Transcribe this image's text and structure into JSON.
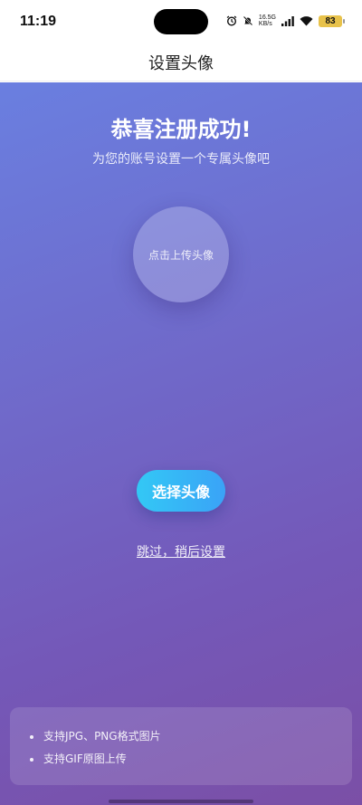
{
  "status_bar": {
    "time": "11:19",
    "net_speed_top": "16.5G",
    "net_speed_bottom": "KB/s",
    "battery": "83"
  },
  "nav": {
    "title": "设置头像"
  },
  "main": {
    "headline": "恭喜注册成功!",
    "subline": "为您的账号设置一个专属头像吧",
    "avatar_hint": "点击上传头像",
    "choose_button": "选择头像",
    "skip_link": "跳过，稍后设置"
  },
  "tips": {
    "items": [
      "支持JPG、PNG格式图片",
      "支持GIF原图上传"
    ]
  },
  "colors": {
    "gradient_start": "#6a7fe0",
    "gradient_end": "#7b4fa6",
    "button_start": "#33c8f5",
    "button_end": "#3aa3f7"
  },
  "icons": [
    "alarm-icon",
    "mute-icon",
    "signal-icon",
    "wifi-icon",
    "battery-icon"
  ]
}
